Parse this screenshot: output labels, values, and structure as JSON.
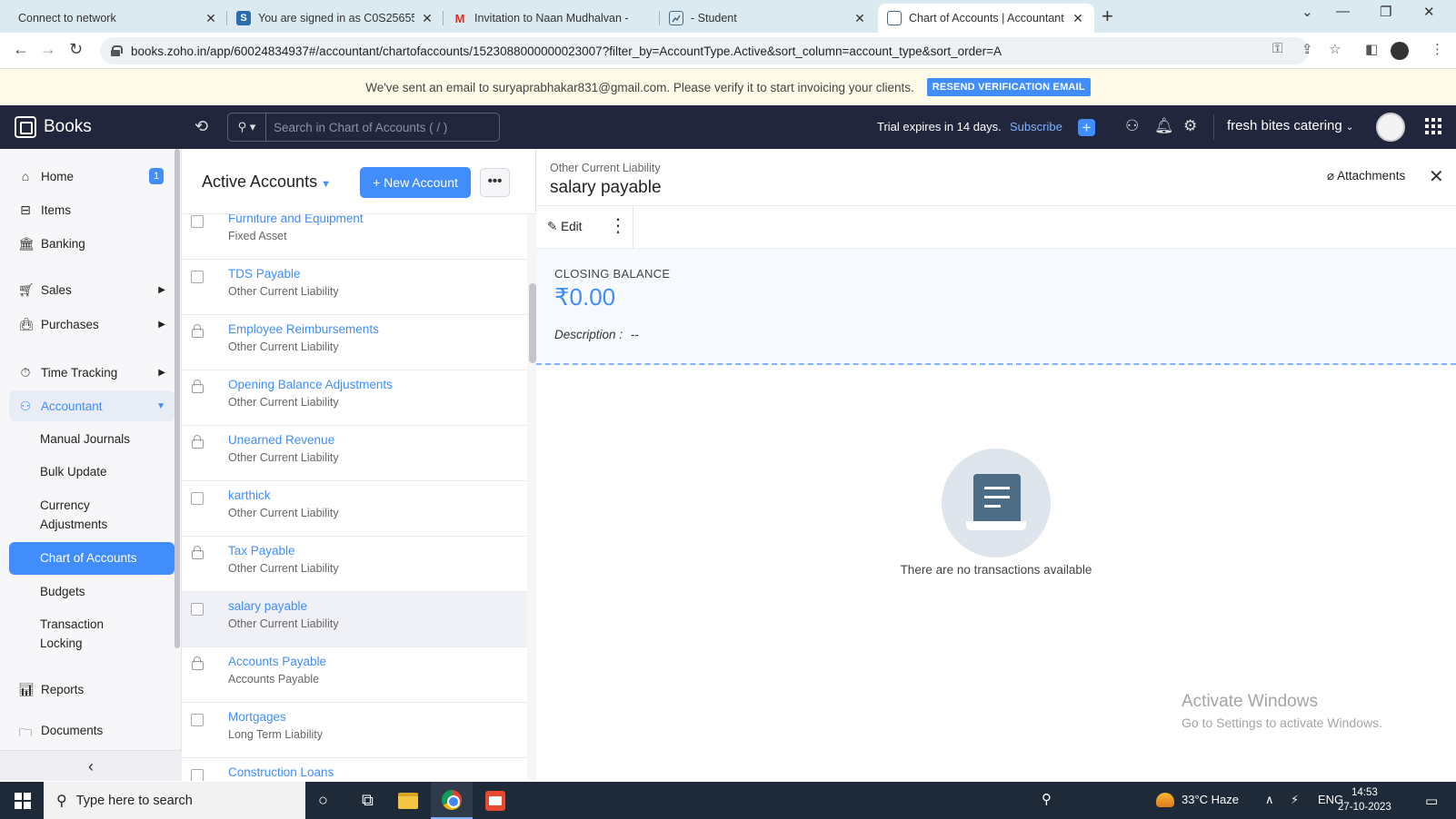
{
  "browser": {
    "tabs": [
      {
        "title": "Connect to network",
        "favicon": ""
      },
      {
        "title": "You are signed in as C0S25655",
        "favicon": "S"
      },
      {
        "title": "Invitation to Naan Mudhalvan -",
        "favicon": "M"
      },
      {
        "title": "- Student",
        "favicon": "chart-icon"
      },
      {
        "title": "Chart of Accounts | Accountant |",
        "favicon": "books-icon"
      }
    ],
    "url": "books.zoho.in/app/60024834937#/accountant/chartofaccounts/1523088000000023007?filter_by=AccountType.Active&sort_column=account_type&sort_order=A"
  },
  "banner": {
    "message": "We've sent an email to suryaprabhakar831@gmail.com. Please verify it to start invoicing your clients.",
    "button": "RESEND VERIFICATION EMAIL"
  },
  "header": {
    "brand": "Books",
    "search_placeholder": "Search in Chart of Accounts ( / )",
    "trial": "Trial expires in 14 days.",
    "subscribe": "Subscribe",
    "org": "fresh bites catering"
  },
  "sidebar": {
    "items": [
      {
        "label": "Home",
        "badge": "1"
      },
      {
        "label": "Items"
      },
      {
        "label": "Banking"
      },
      {
        "label": "Sales"
      },
      {
        "label": "Purchases"
      },
      {
        "label": "Time Tracking"
      },
      {
        "label": "Accountant"
      },
      {
        "label": "Reports"
      },
      {
        "label": "Documents"
      }
    ],
    "accountant_sub": [
      "Manual Journals",
      "Bulk Update",
      "Currency",
      "Adjustments",
      "Chart of Accounts",
      "Budgets",
      "Transaction",
      "Locking"
    ]
  },
  "list": {
    "title": "Active Accounts",
    "new_button": "+ New Account",
    "more": "•••",
    "rows": [
      {
        "name": "Furniture and Equipment",
        "type": "Fixed Asset",
        "locked": false
      },
      {
        "name": "TDS Payable",
        "type": "Other Current Liability",
        "locked": false
      },
      {
        "name": "Employee Reimbursements",
        "type": "Other Current Liability",
        "locked": true
      },
      {
        "name": "Opening Balance Adjustments",
        "type": "Other Current Liability",
        "locked": true
      },
      {
        "name": "Unearned Revenue",
        "type": "Other Current Liability",
        "locked": true
      },
      {
        "name": "karthick",
        "type": "Other Current Liability",
        "locked": false
      },
      {
        "name": "Tax Payable",
        "type": "Other Current Liability",
        "locked": true
      },
      {
        "name": "salary payable",
        "type": "Other Current Liability",
        "locked": false,
        "selected": true
      },
      {
        "name": "Accounts Payable",
        "type": "Accounts Payable",
        "locked": true
      },
      {
        "name": "Mortgages",
        "type": "Long Term Liability",
        "locked": false
      },
      {
        "name": "Construction Loans",
        "type": "",
        "locked": false
      }
    ]
  },
  "detail": {
    "type": "Other Current Liability",
    "name": "salary payable",
    "attachments": "Attachments",
    "edit": "Edit",
    "closing_label": "CLOSING BALANCE",
    "closing_value": "₹0.00",
    "description_label": "Description :",
    "description_value": "--",
    "empty": "There are no transactions available"
  },
  "watermark": {
    "line1": "Activate Windows",
    "line2": "Go to Settings to activate Windows."
  },
  "taskbar": {
    "search": "Type here to search",
    "weather": "33°C  Haze",
    "lang": "ENG",
    "time": "14:53",
    "date": "27-10-2023"
  },
  "colors": {
    "accent": "#408dfb",
    "header_bg": "#21263c",
    "tabstrip_bg": "#dbeaf0"
  }
}
